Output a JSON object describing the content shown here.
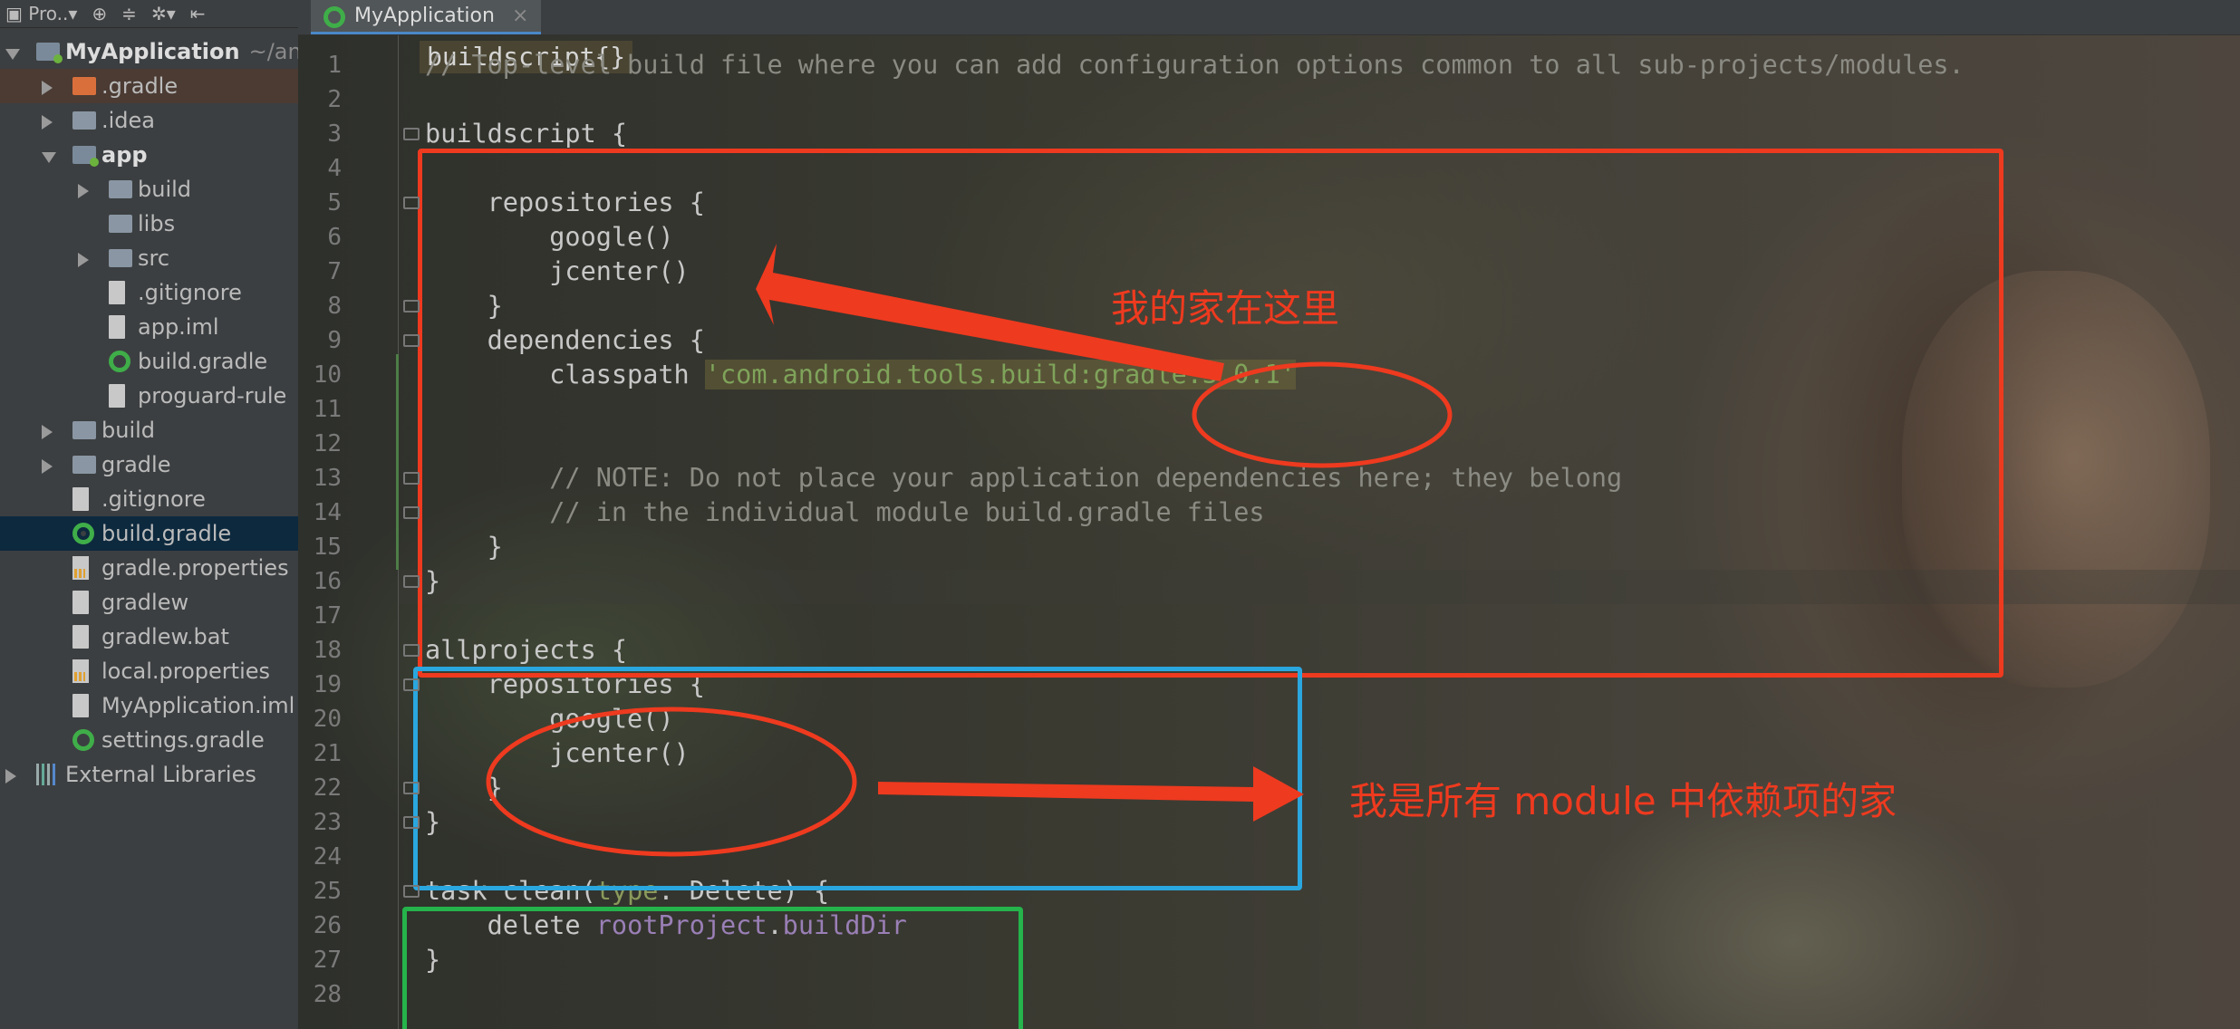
{
  "toolbar": {
    "project_label": "Pro..",
    "icons": [
      "target-icon",
      "collapse-icon",
      "gear-icon",
      "hide-icon"
    ]
  },
  "tree": [
    {
      "label": "MyApplication",
      "suffix": "~/an",
      "depth": 0,
      "arrow": "down",
      "icon": "module",
      "bold": true
    },
    {
      "label": ".gradle",
      "depth": 1,
      "arrow": "right",
      "icon": "folder-orange"
    },
    {
      "label": ".idea",
      "depth": 1,
      "arrow": "right",
      "icon": "folder"
    },
    {
      "label": "app",
      "depth": 1,
      "arrow": "down",
      "icon": "module",
      "bold": true
    },
    {
      "label": "build",
      "depth": 2,
      "arrow": "right",
      "icon": "folder"
    },
    {
      "label": "libs",
      "depth": 2,
      "arrow": "none",
      "icon": "folder"
    },
    {
      "label": "src",
      "depth": 2,
      "arrow": "right",
      "icon": "folder"
    },
    {
      "label": ".gitignore",
      "depth": 2,
      "arrow": "none",
      "icon": "file"
    },
    {
      "label": "app.iml",
      "depth": 2,
      "arrow": "none",
      "icon": "file"
    },
    {
      "label": "build.gradle",
      "depth": 2,
      "arrow": "none",
      "icon": "gradle"
    },
    {
      "label": "proguard-rule",
      "depth": 2,
      "arrow": "none",
      "icon": "file"
    },
    {
      "label": "build",
      "depth": 1,
      "arrow": "right",
      "icon": "folder"
    },
    {
      "label": "gradle",
      "depth": 1,
      "arrow": "right",
      "icon": "folder"
    },
    {
      "label": ".gitignore",
      "depth": 1,
      "arrow": "none",
      "icon": "file"
    },
    {
      "label": "build.gradle",
      "depth": 1,
      "arrow": "none",
      "icon": "gradle",
      "selected": true
    },
    {
      "label": "gradle.properties",
      "depth": 1,
      "arrow": "none",
      "icon": "props"
    },
    {
      "label": "gradlew",
      "depth": 1,
      "arrow": "none",
      "icon": "file"
    },
    {
      "label": "gradlew.bat",
      "depth": 1,
      "arrow": "none",
      "icon": "file"
    },
    {
      "label": "local.properties",
      "depth": 1,
      "arrow": "none",
      "icon": "props"
    },
    {
      "label": "MyApplication.iml",
      "depth": 1,
      "arrow": "none",
      "icon": "file"
    },
    {
      "label": "settings.gradle",
      "depth": 1,
      "arrow": "none",
      "icon": "gradle"
    },
    {
      "label": "External Libraries",
      "depth": 0,
      "arrow": "right",
      "icon": "lib"
    }
  ],
  "editor": {
    "tab_label": "MyApplication",
    "tab_close": "×",
    "breadcrumb": "buildscript{}",
    "lines": [
      {
        "n": "1",
        "segs": [
          {
            "t": "// Top-level build file where you can add configuration options common to all sub-projects/modules.",
            "c": "cm"
          }
        ]
      },
      {
        "n": "2",
        "segs": []
      },
      {
        "n": "3",
        "segs": [
          {
            "t": "buildscript {"
          }
        ]
      },
      {
        "n": "4",
        "segs": []
      },
      {
        "n": "5",
        "segs": [
          {
            "t": "    repositories {"
          }
        ]
      },
      {
        "n": "6",
        "segs": [
          {
            "t": "        google()"
          }
        ]
      },
      {
        "n": "7",
        "segs": [
          {
            "t": "        jcenter()"
          }
        ]
      },
      {
        "n": "8",
        "segs": [
          {
            "t": "    }"
          }
        ]
      },
      {
        "n": "9",
        "segs": [
          {
            "t": "    dependencies {"
          }
        ]
      },
      {
        "n": "10",
        "segs": [
          {
            "t": "        classpath "
          },
          {
            "t": "'com.android.tools.build:gradle:3.0.1'",
            "c": "str"
          }
        ]
      },
      {
        "n": "11",
        "segs": []
      },
      {
        "n": "12",
        "segs": []
      },
      {
        "n": "13",
        "segs": [
          {
            "t": "        // NOTE: Do not place your application dependencies here; they belong",
            "c": "cm"
          }
        ]
      },
      {
        "n": "14",
        "segs": [
          {
            "t": "        // in the individual module build.gradle files",
            "c": "cm"
          }
        ]
      },
      {
        "n": "15",
        "segs": [
          {
            "t": "    }"
          }
        ]
      },
      {
        "n": "16",
        "segs": [
          {
            "t": "}"
          }
        ]
      },
      {
        "n": "17",
        "segs": []
      },
      {
        "n": "18",
        "segs": [
          {
            "t": "allprojects {"
          }
        ]
      },
      {
        "n": "19",
        "segs": [
          {
            "t": "    repositories {"
          }
        ]
      },
      {
        "n": "20",
        "segs": [
          {
            "t": "        google()"
          }
        ]
      },
      {
        "n": "21",
        "segs": [
          {
            "t": "        jcenter()"
          }
        ]
      },
      {
        "n": "22",
        "segs": [
          {
            "t": "    }"
          }
        ]
      },
      {
        "n": "23",
        "segs": [
          {
            "t": "}"
          }
        ]
      },
      {
        "n": "24",
        "segs": []
      },
      {
        "n": "25",
        "segs": [
          {
            "t": "task clean("
          },
          {
            "t": "type",
            "c": "kw"
          },
          {
            "t": ": Delete) {"
          }
        ]
      },
      {
        "n": "26",
        "segs": [
          {
            "t": "    delete "
          },
          {
            "t": "rootProject",
            "c": "prop"
          },
          {
            "t": "."
          },
          {
            "t": "buildDir",
            "c": "prop"
          }
        ]
      },
      {
        "n": "27",
        "segs": [
          {
            "t": "}"
          }
        ]
      },
      {
        "n": "28",
        "segs": []
      }
    ]
  },
  "annotations": {
    "home_label": "我的家在这里",
    "modules_label": "我是所有 module 中依赖项的家",
    "colors": {
      "red": "#ee3a1f",
      "blue": "#2aa7df",
      "green": "#25b34b"
    }
  }
}
